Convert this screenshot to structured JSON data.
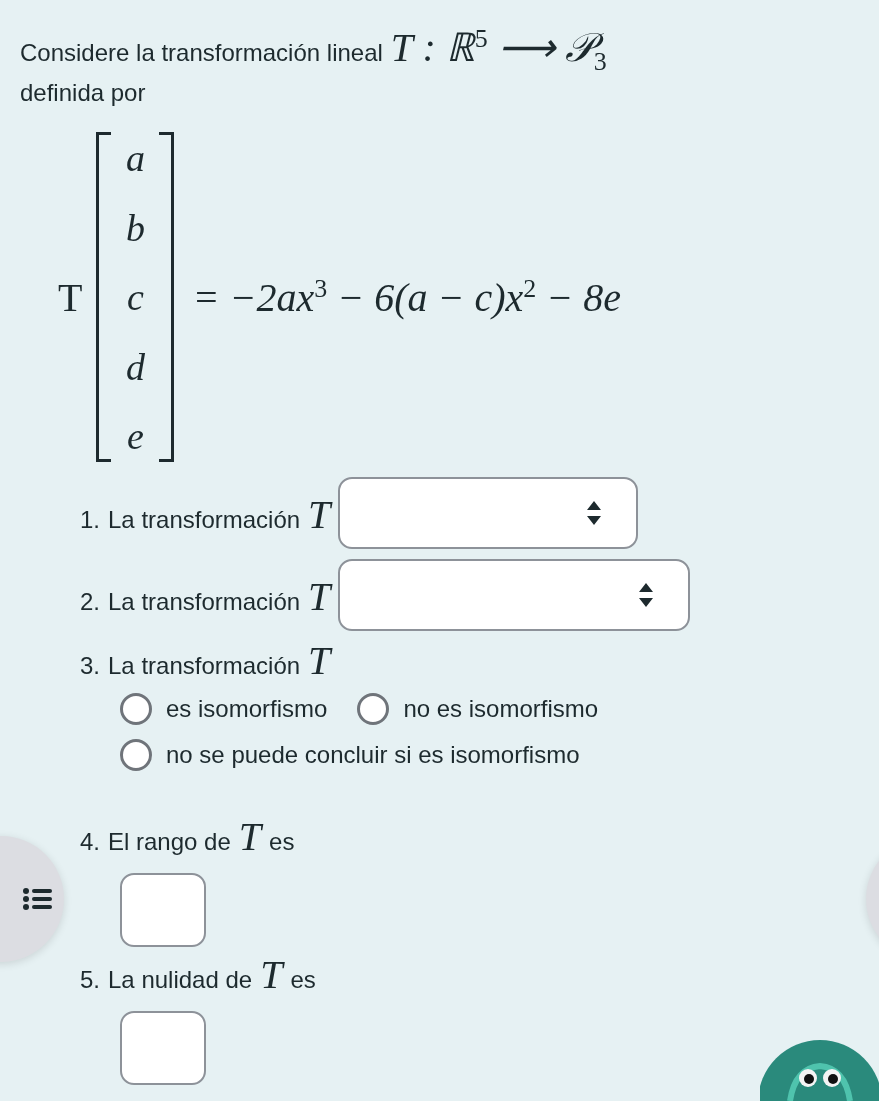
{
  "intro": {
    "text": "Considere la transformación lineal",
    "math": "T : ℝ$^{5}$ ⟶ 𝒫$_{3}$",
    "line2": "definida por"
  },
  "equation": {
    "lhs": "T",
    "entries": [
      "a",
      "b",
      "c",
      "d",
      "e"
    ],
    "rhs": "= −2ax$^{3}$ − 6(a − c)x$^{2}$ − 8e"
  },
  "questions": [
    {
      "kind": "select",
      "number": "1.",
      "text": "La transformación",
      "math": "T"
    },
    {
      "kind": "select",
      "number": "2.",
      "text": "La transformación",
      "math": "T"
    },
    {
      "kind": "radio",
      "number": "3.",
      "text": "La transformación",
      "math": "T",
      "options": [
        {
          "label": "es isomorfismo",
          "selected": false
        },
        {
          "label": "no es isomorfismo",
          "selected": false
        },
        {
          "label": "no se puede concluir si es isomorfismo",
          "selected": false
        }
      ]
    },
    {
      "kind": "input",
      "number": "4.",
      "text": "El rango de",
      "math": "T",
      "suffix": "es"
    },
    {
      "kind": "input",
      "number": "5.",
      "text": "La nulidad de",
      "math": "T",
      "suffix": "es"
    }
  ]
}
